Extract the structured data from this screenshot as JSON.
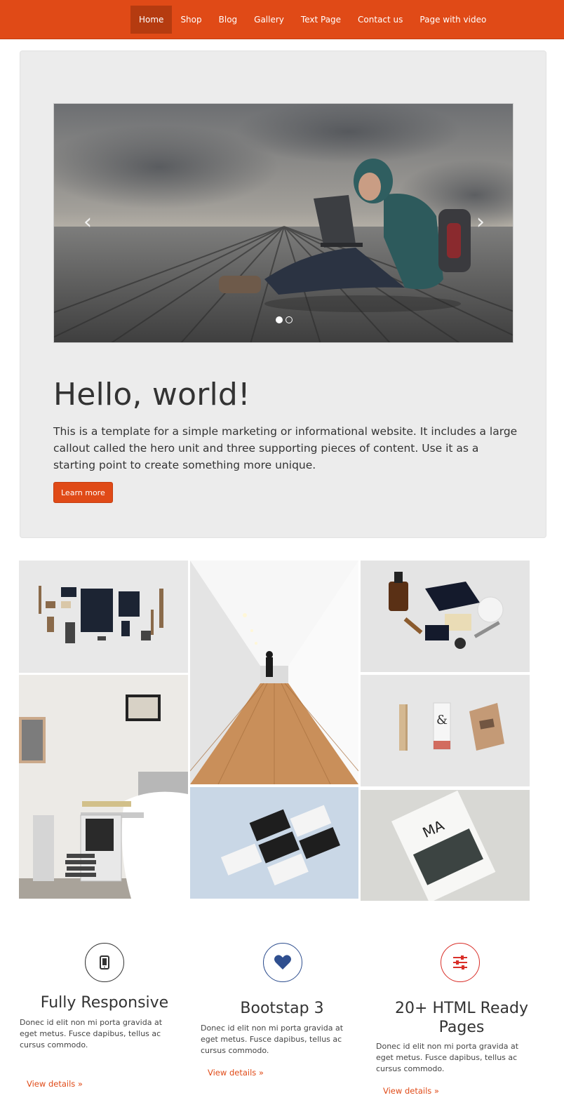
{
  "nav": {
    "items": [
      {
        "label": "Home",
        "active": true
      },
      {
        "label": "Shop"
      },
      {
        "label": "Blog"
      },
      {
        "label": "Gallery"
      },
      {
        "label": "Text Page"
      },
      {
        "label": "Contact us"
      },
      {
        "label": "Page with video"
      }
    ]
  },
  "hero": {
    "carousel": {
      "prev_icon": "chevron-left-icon",
      "next_icon": "chevron-right-icon",
      "slides": 2,
      "active_slide": 1
    },
    "title": "Hello, world!",
    "text": "This is a template for a simple marketing or informational website. It includes a large callout called the hero unit and three supporting pieces of content. Use it as a starting point to create something more unique.",
    "button": "Learn more"
  },
  "features": [
    {
      "icon": "tablet-icon",
      "icon_color": "#333333",
      "title": "Fully Responsive",
      "text": "Donec id elit non mi porta gravida at eget metus. Fusce dapibus, tellus ac cursus commodo.",
      "link": "View details »"
    },
    {
      "icon": "heart-icon",
      "icon_color": "#2f4f8f",
      "title": "Bootstap 3",
      "text": "Donec id elit non mi porta gravida at eget metus. Fusce dapibus, tellus ac cursus commodo.",
      "link": "View details »"
    },
    {
      "icon": "sliders-icon",
      "icon_color": "#d9302a",
      "title": "20+ HTML Ready Pages",
      "text": "Donec id elit non mi porta gravida at eget metus. Fusce dapibus, tellus ac cursus commodo.",
      "link": "View details »"
    }
  ],
  "colors": {
    "accent": "#e04a17",
    "nav_active": "#b53b10",
    "jumbotron_bg": "#ececec"
  }
}
